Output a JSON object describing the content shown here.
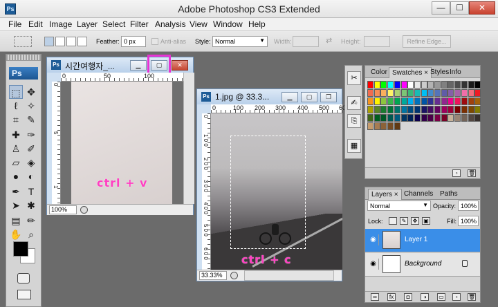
{
  "window": {
    "app_icon": "Ps",
    "title": "Adobe Photoshop CS3 Extended",
    "min": "—",
    "max": "☐",
    "close": "✕"
  },
  "menu": [
    "File",
    "Edit",
    "Image",
    "Layer",
    "Select",
    "Filter",
    "Analysis",
    "View",
    "Window",
    "Help"
  ],
  "options": {
    "feather_label": "Feather:",
    "feather_value": "0 px",
    "antialias_label": "Anti-alias",
    "style_label": "Style:",
    "style_value": "Normal",
    "width_label": "Width:",
    "height_label": "Height:",
    "refine_edge": "Refine Edge..."
  },
  "tools": {
    "logo": "Ps"
  },
  "doc1": {
    "icon": "Ps",
    "title": "시간여행자_...",
    "ruler_h": [
      "0",
      "50",
      "100"
    ],
    "ruler_v": [
      "0",
      "5",
      "1"
    ],
    "zoom": "100%",
    "annotation": "ctrl + v"
  },
  "doc2": {
    "icon": "Ps",
    "title": "1.jpg @ 33.3...",
    "ruler_h": [
      "0",
      "100",
      "200",
      "300",
      "400",
      "500",
      "600"
    ],
    "ruler_v": [
      "0",
      "1 0 0",
      "2 0 0",
      "3 0 0",
      "4 0 0",
      "5 0 0",
      "6 0 0"
    ],
    "zoom": "33.33%",
    "annotation": "ctrl + c"
  },
  "swatch_panel": {
    "tabs": [
      "Color",
      "Swatches ×",
      "Styles",
      "Info"
    ],
    "colors": [
      [
        "#ff0000",
        "#ffff00",
        "#00ff00",
        "#00ffff",
        "#0000ff",
        "#ff00ff",
        "#ffffff",
        "#e6e6e6",
        "#cccccc",
        "#b3b3b3",
        "#999999",
        "#808080",
        "#666666",
        "#4d4d4d",
        "#333333",
        "#1a1a1a",
        "#000000"
      ],
      [
        "#f26c4f",
        "#f68e56",
        "#fbaf5d",
        "#fff568",
        "#acd372",
        "#7cc576",
        "#3bb878",
        "#1abbb4",
        "#00bff3",
        "#438ccb",
        "#5574b9",
        "#605ca8",
        "#855fa8",
        "#a763a8",
        "#f06ea9",
        "#f26d7d",
        "#ee1c24"
      ],
      [
        "#f7941d",
        "#fff200",
        "#8dc63f",
        "#39b54a",
        "#00a651",
        "#00a99d",
        "#00aeef",
        "#0072bc",
        "#0054a6",
        "#2e3192",
        "#662d91",
        "#92278f",
        "#ec008c",
        "#ed145b",
        "#9e0b0f",
        "#a0410d",
        "#a36209"
      ],
      [
        "#aba000",
        "#598527",
        "#1a7b30",
        "#007236",
        "#00746b",
        "#0076a3",
        "#004b80",
        "#003471",
        "#1b1464",
        "#440e62",
        "#630460",
        "#9e005d",
        "#9e0039",
        "#790000",
        "#7b2e00",
        "#7d4900",
        "#827b00"
      ],
      [
        "#406618",
        "#005e20",
        "#005826",
        "#005952",
        "#005b7f",
        "#003663",
        "#002157",
        "#0d004c",
        "#32004b",
        "#4b0049",
        "#7b0046",
        "#7a0026",
        "#c7b299",
        "#998675",
        "#736357",
        "#534741",
        "#37302d"
      ],
      [
        "#c69c6d",
        "#a67c52",
        "#8c6239",
        "#754c24",
        "#603913"
      ]
    ]
  },
  "layers_panel": {
    "tabs": [
      "Layers ×",
      "Channels",
      "Paths"
    ],
    "blend_mode": "Normal",
    "opacity_label": "Opacity:",
    "opacity_value": "100%",
    "lock_label": "Lock:",
    "fill_label": "Fill:",
    "fill_value": "100%",
    "layers": [
      {
        "name": "Layer 1",
        "selected": true,
        "italic": false
      },
      {
        "name": "Background",
        "selected": false,
        "italic": true
      }
    ]
  }
}
